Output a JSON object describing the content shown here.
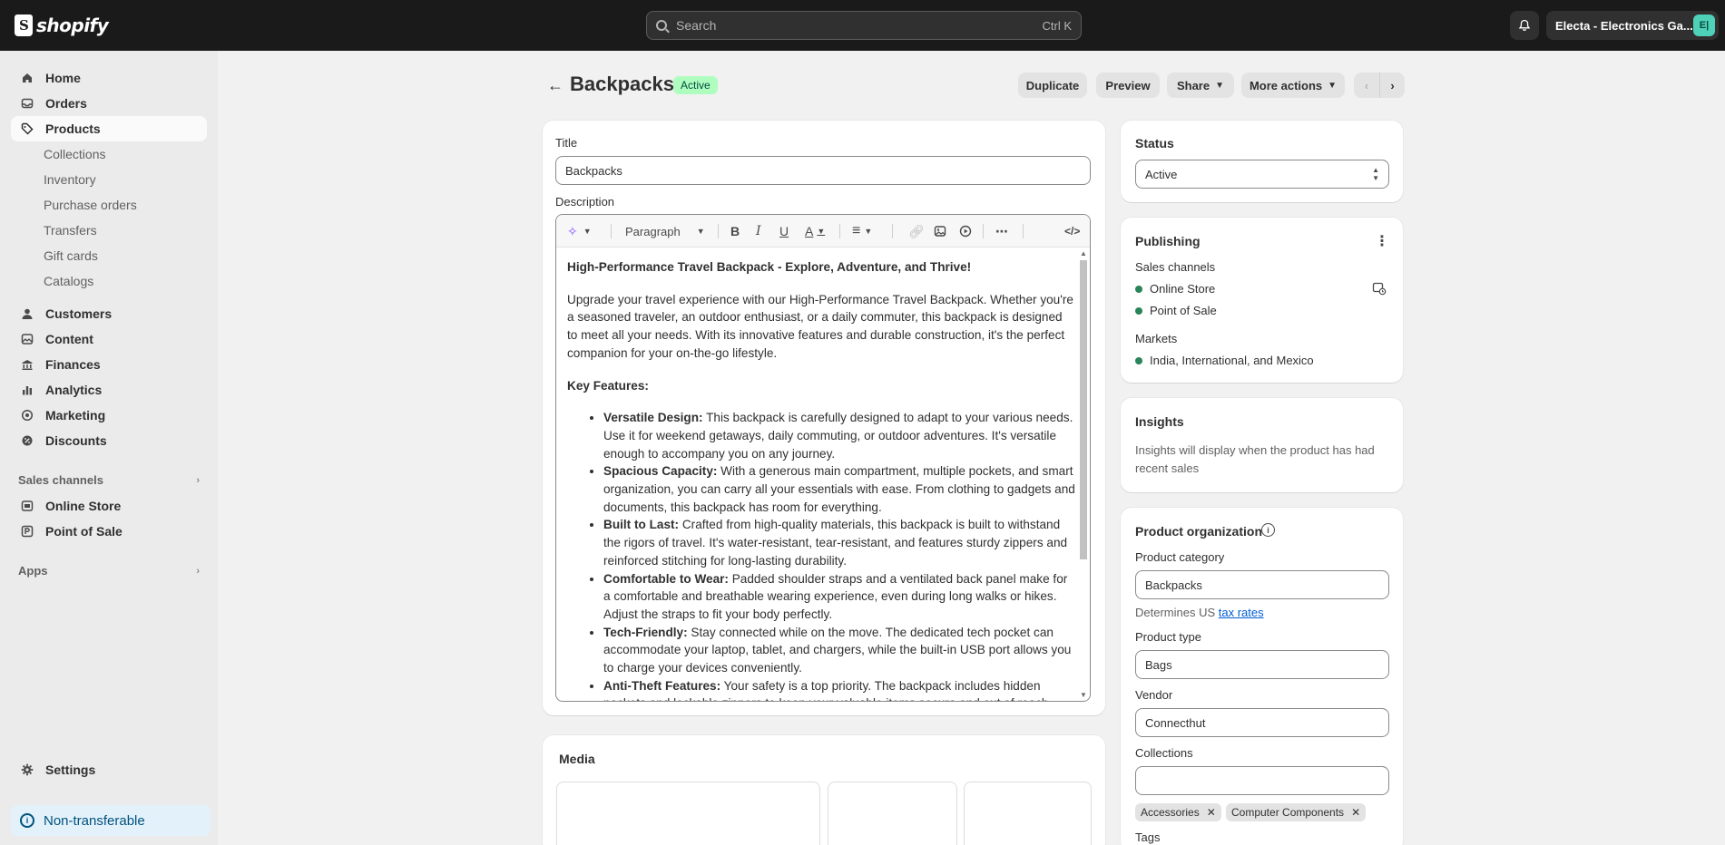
{
  "topbar": {
    "logo_text": "shopify",
    "search_placeholder": "Search",
    "search_shortcut": "Ctrl K",
    "store_name": "Electa - Electronics Ga...",
    "store_initials": "E|"
  },
  "sidebar": {
    "main_items": [
      {
        "label": "Home",
        "icon": "home-icon"
      },
      {
        "label": "Orders",
        "icon": "inbox-icon"
      },
      {
        "label": "Products",
        "icon": "tag-icon"
      }
    ],
    "product_sub_items": [
      "Collections",
      "Inventory",
      "Purchase orders",
      "Transfers",
      "Gift cards",
      "Catalogs"
    ],
    "more_items": [
      {
        "label": "Customers",
        "icon": "person-icon"
      },
      {
        "label": "Content",
        "icon": "content-icon"
      },
      {
        "label": "Finances",
        "icon": "bank-icon"
      },
      {
        "label": "Analytics",
        "icon": "chart-icon"
      },
      {
        "label": "Marketing",
        "icon": "target-icon"
      },
      {
        "label": "Discounts",
        "icon": "discount-icon"
      }
    ],
    "sales_channels_label": "Sales channels",
    "channels": [
      {
        "label": "Online Store",
        "icon": "store-icon"
      },
      {
        "label": "Point of Sale",
        "icon": "pos-icon"
      }
    ],
    "apps_label": "Apps",
    "settings_label": "Settings",
    "non_transferable_label": "Non-transferable"
  },
  "header": {
    "title": "Backpacks",
    "status_badge": "Active",
    "duplicate_label": "Duplicate",
    "preview_label": "Preview",
    "share_label": "Share",
    "more_actions_label": "More actions"
  },
  "main": {
    "title_label": "Title",
    "title_value": "Backpacks",
    "description_label": "Description",
    "toolbar": {
      "paragraph_label": "Paragraph"
    },
    "description": {
      "heading": "High-Performance Travel Backpack - Explore, Adventure, and Thrive!",
      "intro": "Upgrade your travel experience with our High-Performance Travel Backpack. Whether you're a seasoned traveler, an outdoor enthusiast, or a daily commuter, this backpack is designed to meet all your needs. With its innovative features and durable construction, it's the perfect companion for your on-the-go lifestyle.",
      "features_heading": "Key Features:",
      "features": [
        {
          "title": "Versatile Design:",
          "text": " This backpack is carefully designed to adapt to your various needs. Use it for weekend getaways, daily commuting, or outdoor adventures. It's versatile enough to accompany you on any journey."
        },
        {
          "title": "Spacious Capacity:",
          "text": " With a generous main compartment, multiple pockets, and smart organization, you can carry all your essentials with ease. From clothing to gadgets and documents, this backpack has room for everything."
        },
        {
          "title": "Built to Last:",
          "text": " Crafted from high-quality materials, this backpack is built to withstand the rigors of travel. It's water-resistant, tear-resistant, and features sturdy zippers and reinforced stitching for long-lasting durability."
        },
        {
          "title": "Comfortable to Wear:",
          "text": " Padded shoulder straps and a ventilated back panel make for a comfortable and breathable wearing experience, even during long walks or hikes. Adjust the straps to fit your body perfectly."
        },
        {
          "title": "Tech-Friendly:",
          "text": " Stay connected while on the move. The dedicated tech pocket can accommodate your laptop, tablet, and chargers, while the built-in USB port allows you to charge your devices conveniently."
        },
        {
          "title": "Anti-Theft Features:",
          "text": " Your safety is a top priority. The backpack includes hidden pockets and lockable zippers to keep your valuable items secure and out of reach."
        }
      ]
    },
    "media_label": "Media"
  },
  "right": {
    "status_label": "Status",
    "status_value": "Active",
    "publishing_label": "Publishing",
    "sales_channels_label": "Sales channels",
    "channels": [
      "Online Store",
      "Point of Sale"
    ],
    "markets_label": "Markets",
    "markets_value": "India, International, and Mexico",
    "insights_label": "Insights",
    "insights_text": "Insights will display when the product has had recent sales",
    "org_label": "Product organization",
    "category_label": "Product category",
    "category_value": "Backpacks",
    "tax_prefix": "Determines US ",
    "tax_link": "tax rates",
    "type_label": "Product type",
    "type_value": "Bags",
    "vendor_label": "Vendor",
    "vendor_value": "Connecthut",
    "collections_label": "Collections",
    "collections_tags": [
      "Accessories",
      "Computer Components"
    ],
    "tags_label": "Tags"
  }
}
